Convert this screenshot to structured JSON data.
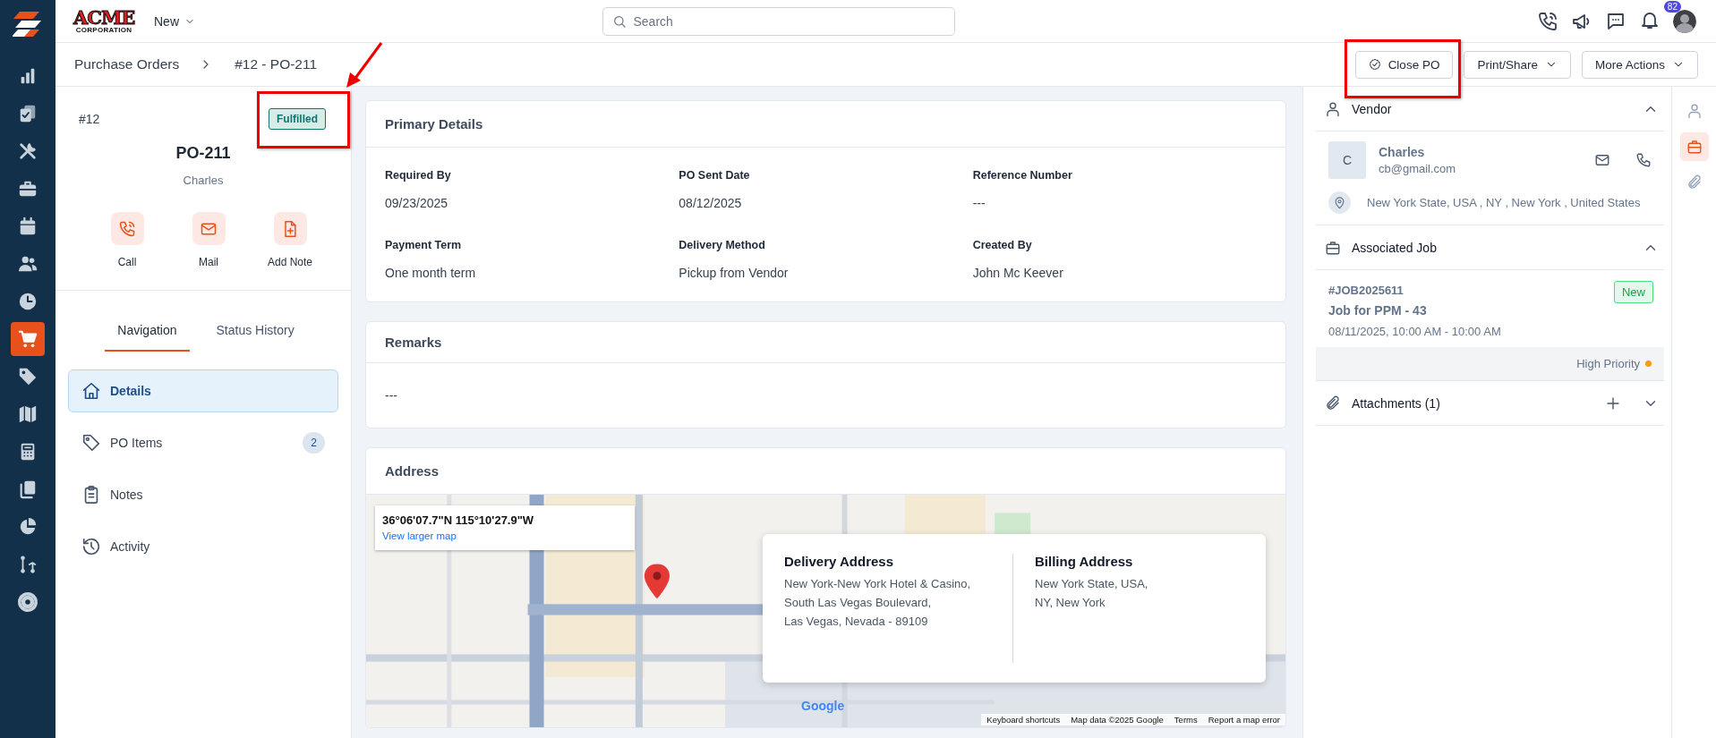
{
  "top_bar": {
    "logo": {
      "word": "ACME",
      "tagline": "CORPORATION"
    },
    "new_menu": "New",
    "search": {
      "placeholder": "Search"
    },
    "notification_count": "82"
  },
  "nav_rail": [
    {
      "selected": false
    },
    {
      "selected": false
    },
    {
      "selected": false
    },
    {
      "selected": false
    },
    {
      "selected": false
    },
    {
      "selected": false
    },
    {
      "selected": false
    },
    {
      "selected": true
    },
    {
      "selected": false
    },
    {
      "selected": false
    },
    {
      "selected": false
    },
    {
      "selected": false
    },
    {
      "selected": false
    },
    {
      "selected": false
    },
    {
      "selected": false
    }
  ],
  "breadcrumb": [
    "Purchase Orders",
    "#12 - PO-211"
  ],
  "actions": [
    {
      "label": "Close PO",
      "kind": "check"
    },
    {
      "label": "Print/Share",
      "kind": "dropdown"
    },
    {
      "label": "More Actions",
      "kind": "dropdown"
    }
  ],
  "summary": {
    "number": "#12",
    "status": "Fulfilled",
    "title": "PO-211",
    "vendor": "Charles",
    "quick_actions": [
      "Call",
      "Mail",
      "Add Note"
    ]
  },
  "tabs": [
    {
      "label": "Navigation",
      "selected": true
    },
    {
      "label": "Status History",
      "selected": false
    }
  ],
  "nav_items": [
    {
      "label": "Details",
      "selected": true
    },
    {
      "label": "PO Items",
      "selected": false,
      "count": "2"
    },
    {
      "label": "Notes",
      "selected": false
    },
    {
      "label": "Activity",
      "selected": false
    }
  ],
  "primary_details": {
    "title": "Primary Details",
    "fields": [
      {
        "label": "Required By",
        "value": "09/23/2025"
      },
      {
        "label": "PO Sent Date",
        "value": "08/12/2025"
      },
      {
        "label": "Reference Number",
        "value": "---"
      },
      {
        "label": "Payment Term",
        "value": "One month term"
      },
      {
        "label": "Delivery Method",
        "value": "Pickup from Vendor"
      },
      {
        "label": "Created By",
        "value": "John Mc Keever"
      }
    ]
  },
  "remarks": {
    "title": "Remarks",
    "text": "---"
  },
  "address": {
    "title": "Address",
    "map": {
      "kind": "picture",
      "coordinates": "36°06'07.7\"N 115°10'27.9\"W",
      "link": "View larger map",
      "logo": "Google",
      "attribution": [
        "Keyboard shortcuts",
        "Map data ©2025 Google",
        "Terms",
        "Report a map error"
      ]
    },
    "delivery": {
      "title": "Delivery Address",
      "lines": [
        "New York-New York Hotel & Casino,",
        "South Las Vegas Boulevard,",
        "Las Vegas, Nevada - 89109"
      ]
    },
    "billing": {
      "title": "Billing Address",
      "lines": [
        "New York State, USA,",
        "NY, New York"
      ]
    }
  },
  "vendor": {
    "title": "Vendor",
    "expanded": true,
    "initial": "C",
    "name": "Charles",
    "email": "cb@gmail.com",
    "location": "New York State, USA , NY , New York , United States"
  },
  "associated_job": {
    "title": "Associated Job",
    "expanded": true,
    "id": "#JOB2025611",
    "status": "New",
    "name": "Job for PPM - 43",
    "schedule": "08/11/2025, 10:00 AM - 10:00 AM",
    "priority": "High Priority"
  },
  "attachments": {
    "title": "Attachments (1)",
    "expanded": false
  },
  "right_rail": [
    {
      "selected": false
    },
    {
      "selected": true
    },
    {
      "selected": false
    }
  ]
}
